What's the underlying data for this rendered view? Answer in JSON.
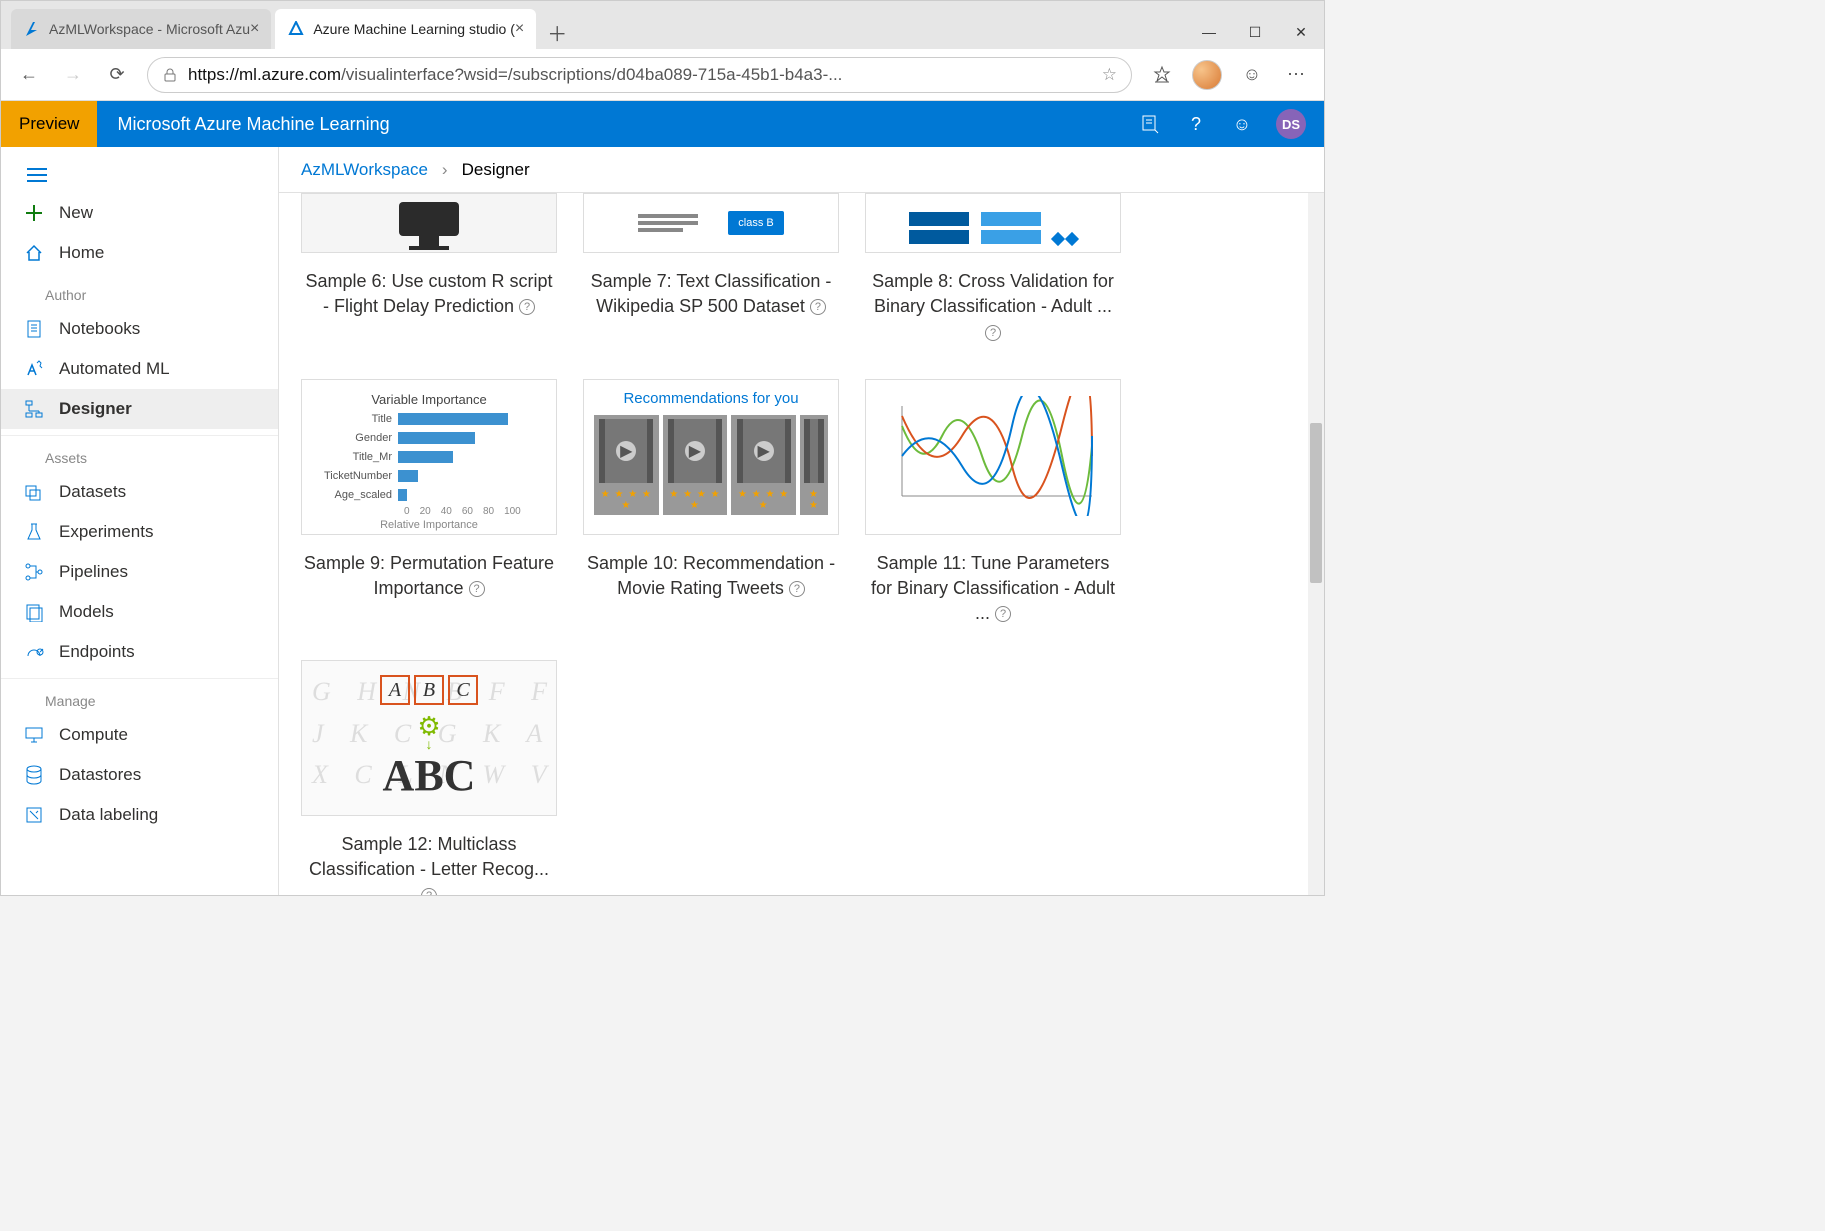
{
  "browser": {
    "tabs": [
      {
        "title": "AzMLWorkspace - Microsoft Azu",
        "active": false
      },
      {
        "title": "Azure Machine Learning studio (",
        "active": true
      }
    ],
    "url_host": "https://ml.azure.com",
    "url_path": "/visualinterface?wsid=/subscriptions/d04ba089-715a-45b1-b4a3-..."
  },
  "header": {
    "preview_label": "Preview",
    "brand": "Microsoft Azure Machine Learning",
    "user_initials": "DS"
  },
  "sidebar": {
    "new_label": "New",
    "home_label": "Home",
    "sections": {
      "author": "Author",
      "assets": "Assets",
      "manage": "Manage"
    },
    "items": {
      "notebooks": "Notebooks",
      "automated_ml": "Automated ML",
      "designer": "Designer",
      "datasets": "Datasets",
      "experiments": "Experiments",
      "pipelines": "Pipelines",
      "models": "Models",
      "endpoints": "Endpoints",
      "compute": "Compute",
      "datastores": "Datastores",
      "data_labeling": "Data labeling"
    }
  },
  "breadcrumb": {
    "workspace": "AzMLWorkspace",
    "current": "Designer"
  },
  "cards": {
    "s6": "Sample 6: Use custom R script - Flight Delay Prediction",
    "s7": "Sample 7: Text Classification - Wikipedia SP 500 Dataset",
    "s8": "Sample 8: Cross Validation for Binary Classification - Adult ...",
    "s9": "Sample 9: Permutation Feature Importance",
    "s10": "Sample 10: Recommendation - Movie Rating Tweets",
    "s11": "Sample 11: Tune Parameters for Binary Classification - Adult ...",
    "s12": "Sample 12: Multiclass Classification - Letter Recog..."
  },
  "card9_chart": {
    "title": "Variable Importance",
    "subtitle": "Relative Importance",
    "axis": [
      "0",
      "20",
      "40",
      "60",
      "80",
      "100"
    ],
    "rows": [
      {
        "label": "Title",
        "value": 100
      },
      {
        "label": "Gender",
        "value": 70
      },
      {
        "label": "Title_Mr",
        "value": 50
      },
      {
        "label": "TicketNumber",
        "value": 18
      },
      {
        "label": "Age_scaled",
        "value": 8
      }
    ]
  },
  "card10": {
    "heading": "Recommendations for you",
    "stars": "★ ★ ★ ★ ★"
  },
  "card7_badge": "class B"
}
